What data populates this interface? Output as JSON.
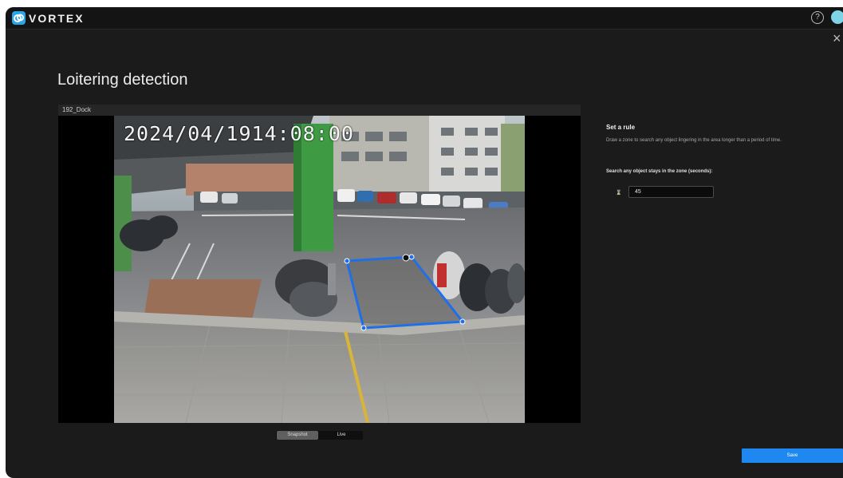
{
  "app": {
    "brand": "VORTEX"
  },
  "header": {
    "help_glyph": "?"
  },
  "dialog": {
    "close_glyph": "×"
  },
  "page": {
    "title": "Loitering detection"
  },
  "camera": {
    "name": "192_Dock",
    "timestamp": "2024/04/1914:08:00"
  },
  "view_toggle": {
    "options": [
      "Snapshot",
      "Live"
    ],
    "selected": "Snapshot"
  },
  "rule": {
    "title": "Set a rule",
    "description": "Draw a zone to search any object lingering in the area longer than a period of time.",
    "field_label": "Search any object stays in the zone (seconds):",
    "field_icon": "hourglass-icon",
    "field_value": "45"
  },
  "actions": {
    "save_label": "Save"
  },
  "colors": {
    "accent": "#1e88f0",
    "zone": "#1f6fe8",
    "background": "#1b1b1b"
  }
}
